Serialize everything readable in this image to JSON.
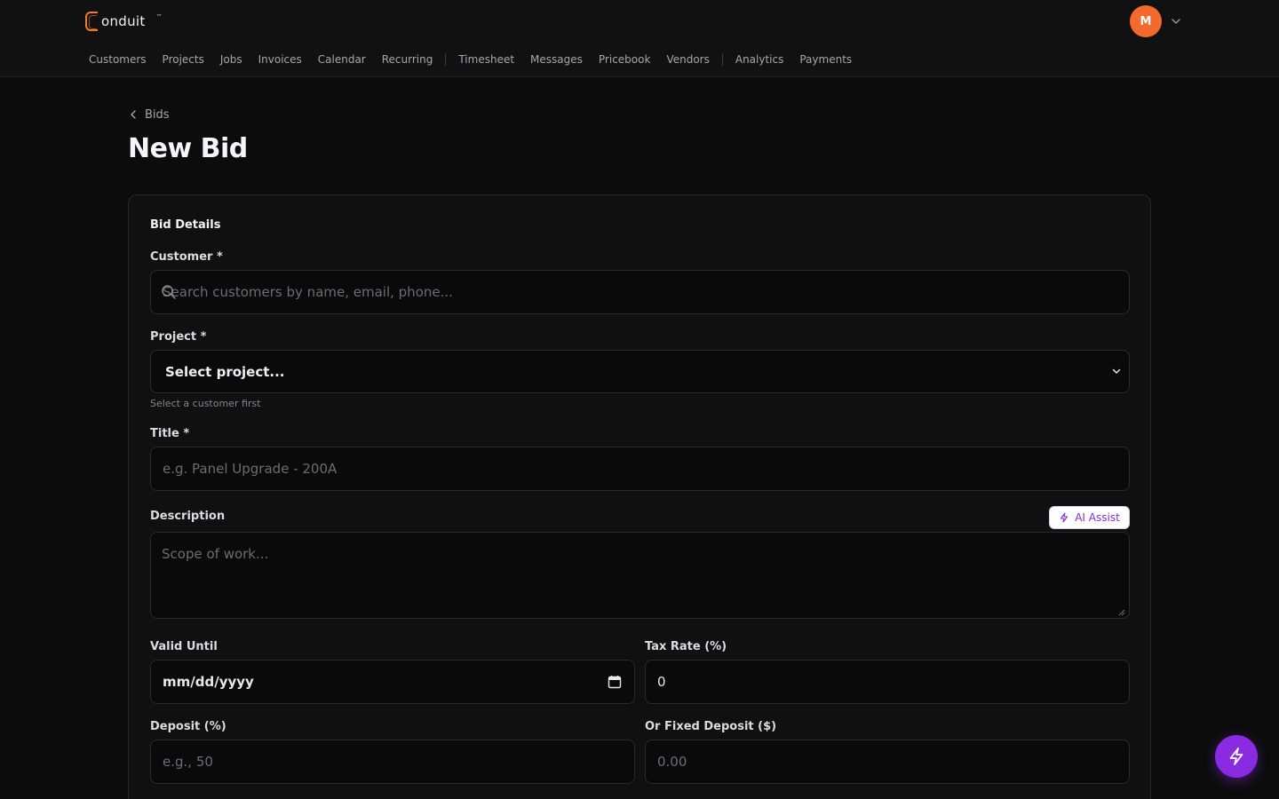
{
  "app": {
    "logo_text": "onduit",
    "logo_tm": "™",
    "user_initial": "M"
  },
  "nav": {
    "items": [
      "Customers",
      "Projects",
      "Jobs",
      "Invoices",
      "Calendar",
      "Recurring",
      "Timesheet",
      "Messages",
      "Pricebook",
      "Vendors",
      "Analytics",
      "Payments"
    ]
  },
  "breadcrumb": {
    "back_label": "Bids"
  },
  "page": {
    "title": "New Bid"
  },
  "form": {
    "section_title": "Bid Details",
    "customer": {
      "label": "Customer *",
      "placeholder": "Search customers by name, email, phone..."
    },
    "project": {
      "label": "Project *",
      "selected": "Select project...",
      "hint": "Select a customer first"
    },
    "title": {
      "label": "Title *",
      "placeholder": "e.g. Panel Upgrade - 200A"
    },
    "description": {
      "label": "Description",
      "placeholder": "Scope of work...",
      "ai_assist_label": "AI Assist"
    },
    "valid_until": {
      "label": "Valid Until",
      "value": "mm/dd/yyyy"
    },
    "tax_rate": {
      "label": "Tax Rate (%)",
      "value": "0"
    },
    "deposit_percent": {
      "label": "Deposit (%)",
      "placeholder": "e.g., 50"
    },
    "fixed_deposit": {
      "label": "Or Fixed Deposit ($)",
      "placeholder": "0.00"
    }
  },
  "colors": {
    "brand": "#f07a2a",
    "avatar": "#f26a2e",
    "accent": "#8a2be2",
    "ai_text": "#7b2fe0"
  },
  "icons": {
    "logo": "conduit-c-logo-icon",
    "user_menu": "chevron-down-icon",
    "back": "chevron-left-icon",
    "search": "search-icon",
    "select": "chevron-down-icon",
    "ai": "lightning-icon",
    "calendar": "calendar-icon",
    "fab": "lightning-icon"
  }
}
